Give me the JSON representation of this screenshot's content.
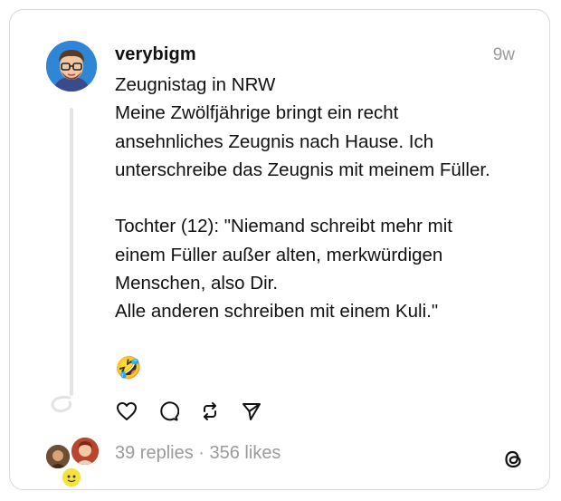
{
  "post": {
    "username": "verybigm",
    "time": "9w",
    "text_lines": [
      "Zeugnistag in NRW",
      "Meine Zwölfjährige bringt ein recht",
      "ansehnliches Zeugnis nach Hause. Ich",
      "unterschreibe das Zeugnis mit meinem Füller.",
      "",
      "Tochter (12): \"Niemand schreibt mehr mit",
      "einem Füller außer alten, merkwürdigen",
      "Menschen, also Dir.",
      "Alle anderen schreiben mit einem Kuli.\""
    ],
    "emoji": "🤣"
  },
  "actions": {
    "like_icon": "heart-icon",
    "reply_icon": "comment-icon",
    "repost_icon": "repost-icon",
    "share_icon": "send-icon"
  },
  "stats": {
    "replies": "39 replies",
    "separator": " · ",
    "likes": "356 likes"
  },
  "colors": {
    "text": "#111111",
    "muted": "#9a9a9a",
    "border": "#d9d9d9",
    "avatar_bg": "#2f86d6"
  }
}
